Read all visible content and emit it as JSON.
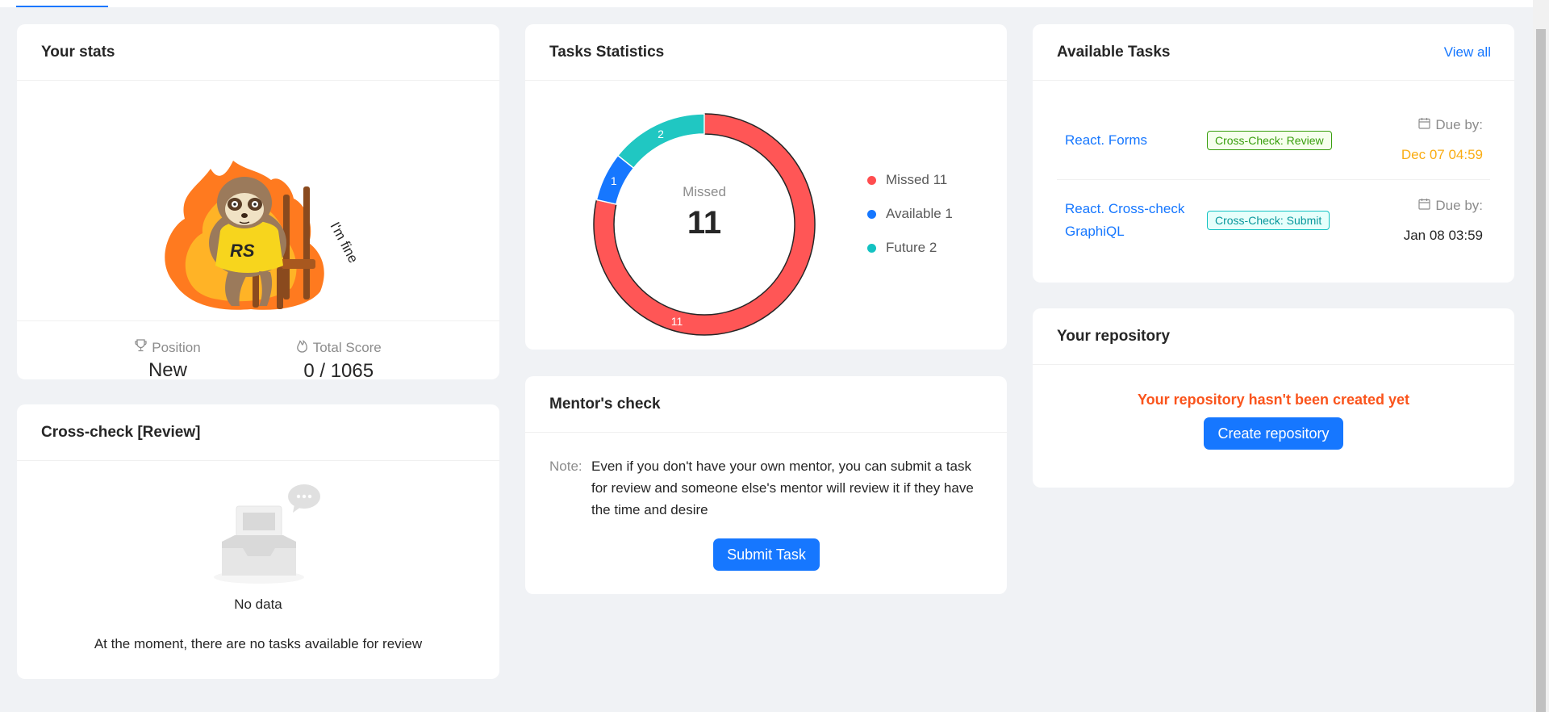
{
  "stats": {
    "title": "Your stats",
    "sticker_text": "I'm fine",
    "sticker_badge": "RS",
    "position_label": "Position",
    "position_value": "New",
    "score_label": "Total Score",
    "score_value": "0 / 1065"
  },
  "crosscheck": {
    "title": "Cross-check [Review]",
    "empty_label": "No data",
    "message": "At the moment, there are no tasks available for review"
  },
  "tasks_stats": {
    "title": "Tasks Statistics",
    "center_label": "Missed",
    "center_value": "11",
    "legend": [
      {
        "label": "Missed 11",
        "color": "#ff5656"
      },
      {
        "label": "Available 1",
        "color": "#1677ff"
      },
      {
        "label": "Future 2",
        "color": "#13c2c2"
      }
    ]
  },
  "chart_data": {
    "type": "pie",
    "categories": [
      "Missed",
      "Available",
      "Future"
    ],
    "values": [
      11,
      1,
      2
    ],
    "colors": [
      "#ff5656",
      "#1677ff",
      "#20c7c2"
    ],
    "donut": true
  },
  "mentor": {
    "title": "Mentor's check",
    "note_label": "Note:",
    "note_text": "Even if you don't have your own mentor, you can submit a task for review and someone else's mentor will review it if they have the time and desire",
    "submit_label": "Submit Task"
  },
  "available": {
    "title": "Available Tasks",
    "view_all": "View all",
    "tasks": [
      {
        "name": "React. Forms",
        "tag": "Cross-Check: Review",
        "due_label": "Due by:",
        "due_date": "Dec 07 04:59"
      },
      {
        "name": "React. Cross-check GraphiQL",
        "tag": "Cross-Check: Submit",
        "due_label": "Due by:",
        "due_date": "Jan 08 03:59"
      }
    ],
    "colors": {
      "review_tag": "#52c41a",
      "submit_tag": "#13c2c2",
      "due_soon": "#faad14"
    }
  },
  "repository": {
    "title": "Your repository",
    "warning": "Your repository hasn't been created yet",
    "create_label": "Create repository",
    "warning_color": "#fa541c"
  }
}
